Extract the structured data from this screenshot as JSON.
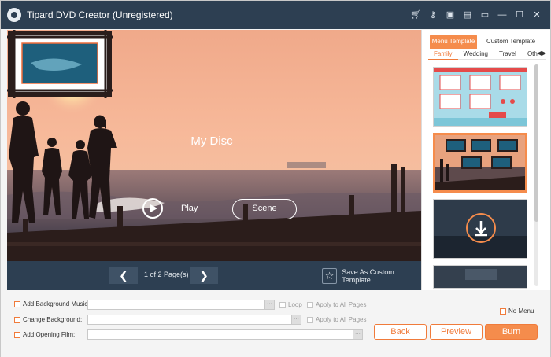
{
  "app": {
    "title": "Tipard DVD Creator (Unregistered)"
  },
  "title_icons": [
    "cart-icon",
    "key-icon",
    "save-icon",
    "document-icon",
    "chat-icon",
    "minimize-icon",
    "maximize-icon",
    "close-icon"
  ],
  "preview": {
    "disc_title": "My Disc",
    "play_label": "Play",
    "scene_label": "Scene"
  },
  "nav": {
    "prev_glyph": "❮",
    "next_glyph": "❯",
    "page_info": "1 of 2 Page(s)",
    "save_template_label": "Save As Custom Template"
  },
  "side": {
    "tabs": [
      "Menu Template",
      "Custom Template"
    ],
    "subtabs": [
      "Family",
      "Wedding",
      "Travel",
      "Oth"
    ],
    "arrows": "◀▶"
  },
  "options": {
    "bg_music_label": "Add Background Music:",
    "change_bg_label": "Change Background:",
    "opening_film_label": "Add Opening Film:",
    "loop_label": "Loop",
    "apply_all_label": "Apply to All Pages",
    "no_menu_label": "No Menu",
    "browse_glyph": "···"
  },
  "buttons": {
    "back": "Back",
    "preview": "Preview",
    "burn": "Burn"
  },
  "colors": {
    "titlebar": "#2d3f52",
    "accent": "#f58c4c"
  }
}
